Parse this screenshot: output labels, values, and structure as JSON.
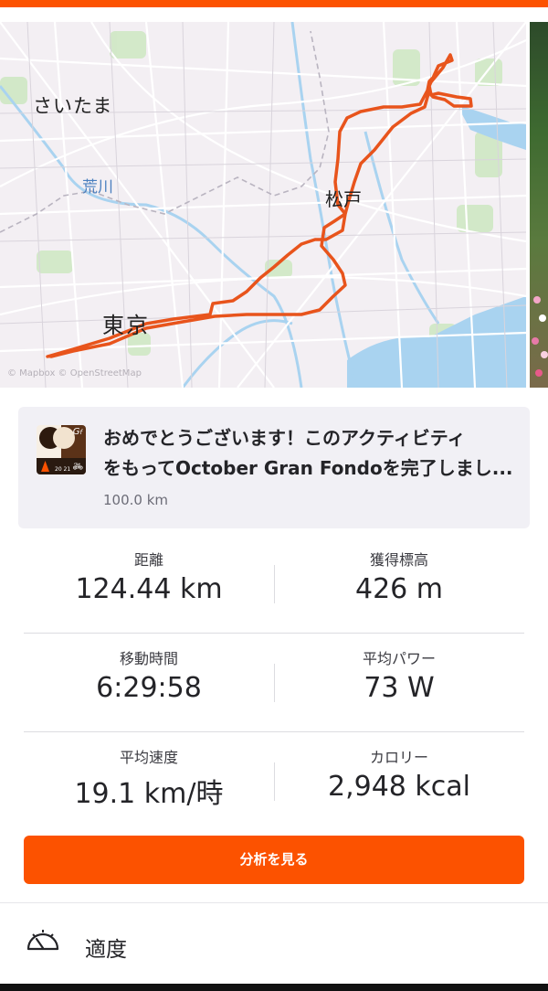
{
  "map": {
    "labels": {
      "saitama": "さいたま",
      "arakawa": "荒川",
      "matsudo": "松戸",
      "tokyo": "東京"
    },
    "attribution": "© Mapbox © OpenStreetMap",
    "route_color": "#e8541c"
  },
  "achievement": {
    "line1": "おめでとうございます！このアクティビティ",
    "line2": "をもってOctober Gran Fondoを完了しまし...",
    "subtitle": "100.0 km",
    "badge_year": "20 21",
    "badge_icon": "bike-icon"
  },
  "stats": [
    [
      {
        "label": "距離",
        "value": "124.44 km"
      },
      {
        "label": "獲得標高",
        "value": "426 m"
      }
    ],
    [
      {
        "label": "移動時間",
        "value": "6:29:58"
      },
      {
        "label": "平均パワー",
        "value": "73 W"
      }
    ],
    [
      {
        "label": "平均速度",
        "value": "19.1 km/時"
      },
      {
        "label": "カロリー",
        "value": "2,948 kcal"
      }
    ]
  ],
  "analyze_button": "分析を見る",
  "fitness": {
    "label": "適度",
    "icon": "gauge-icon"
  },
  "colors": {
    "accent": "#fc5200"
  }
}
